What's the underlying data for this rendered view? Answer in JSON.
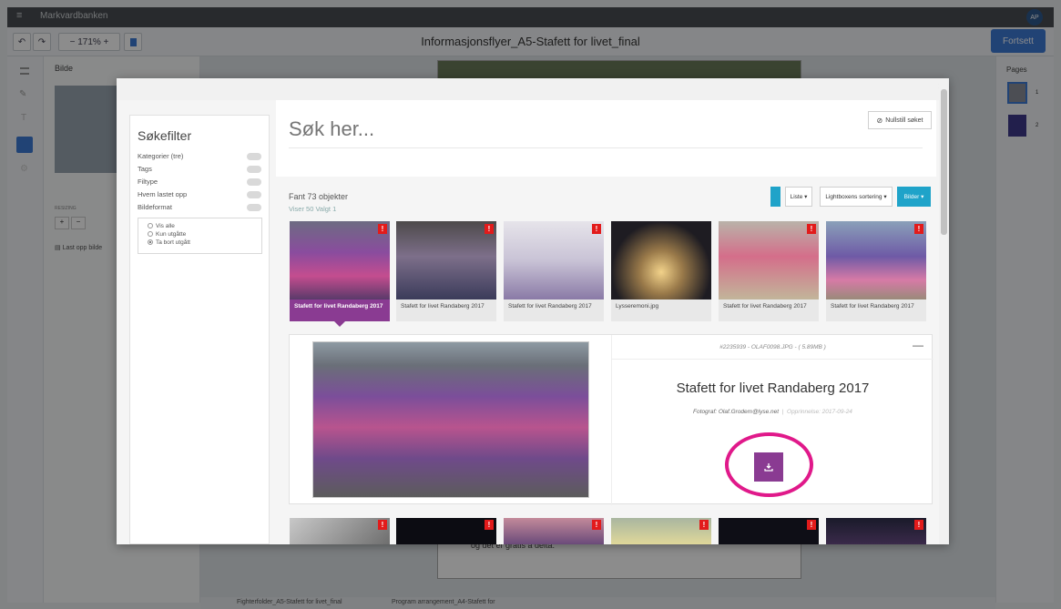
{
  "app": {
    "top_label": "Markvardbanken",
    "document_title": "Informasjonsflyer_A5-Stafett for livet_final",
    "zoom": "171%",
    "continue_label": "Fortsett",
    "left_panel_title": "Bilde",
    "resizing_label": "RESIZING",
    "upload_label": "Last opp bilde",
    "pages_label": "Pages",
    "page_numbers": [
      "1",
      "2"
    ],
    "page_text_snippet": "og det er gratis å delta.",
    "bottom_tabs": [
      "Fighterfolder_A5-Stafett for livet_final",
      "Program arrangement_A4-Stafett for"
    ],
    "avatar_initials": "AP"
  },
  "filter": {
    "title": "Søkefilter",
    "items": [
      {
        "label": "Kategorier (tre)"
      },
      {
        "label": "Tags"
      },
      {
        "label": "Filtype"
      },
      {
        "label": "Hvem lastet opp"
      },
      {
        "label": "Bildeformat"
      }
    ],
    "radio": [
      {
        "label": "Vis alle",
        "checked": false
      },
      {
        "label": "Kun utgåtte",
        "checked": false
      },
      {
        "label": "Ta bort utgått",
        "checked": true
      }
    ]
  },
  "search": {
    "placeholder": "Søk her...",
    "reset_label": "Nullstill søket"
  },
  "results": {
    "found": "Fant 73 objekter",
    "shown": "Viser 50   Valgt 1",
    "view_label": "Liste",
    "sort_label": "Lightboxens sortering",
    "type_label": "Bilder",
    "thumbnails": [
      {
        "caption": "Stafett for livet Randaberg 2017",
        "selected": true,
        "badge": "!"
      },
      {
        "caption": "Stafett for livet Randaberg 2017",
        "selected": false,
        "badge": "!"
      },
      {
        "caption": "Stafett for livet Randaberg 2017",
        "selected": false,
        "badge": "!"
      },
      {
        "caption": "Lysseremoni.jpg",
        "selected": false,
        "badge": ""
      },
      {
        "caption": "Stafett for livet Randaberg 2017",
        "selected": false,
        "badge": "!"
      },
      {
        "caption": "Stafett for livet Randaberg 2017",
        "selected": false,
        "badge": "!"
      }
    ],
    "row2_badges": [
      "!",
      "!",
      "!",
      "!",
      "!",
      "!"
    ]
  },
  "detail": {
    "meta": "#2235939 - OLAF0098.JPG -  ( 5.89MB )",
    "title": "Stafett for livet Randaberg 2017",
    "photographer": "Fotograf: Olaf.Grodem@lyse.net",
    "origin": "Opprinnelse: 2017-09-24",
    "collapse_icon": "—",
    "download_icon": "download-icon"
  },
  "colors": {
    "accent_purple": "#8a3b92",
    "accent_teal": "#1fa3c9",
    "highlight_ring": "#e0198a",
    "badge_red": "#e21b1b",
    "primary_blue": "#3d7ad6"
  }
}
